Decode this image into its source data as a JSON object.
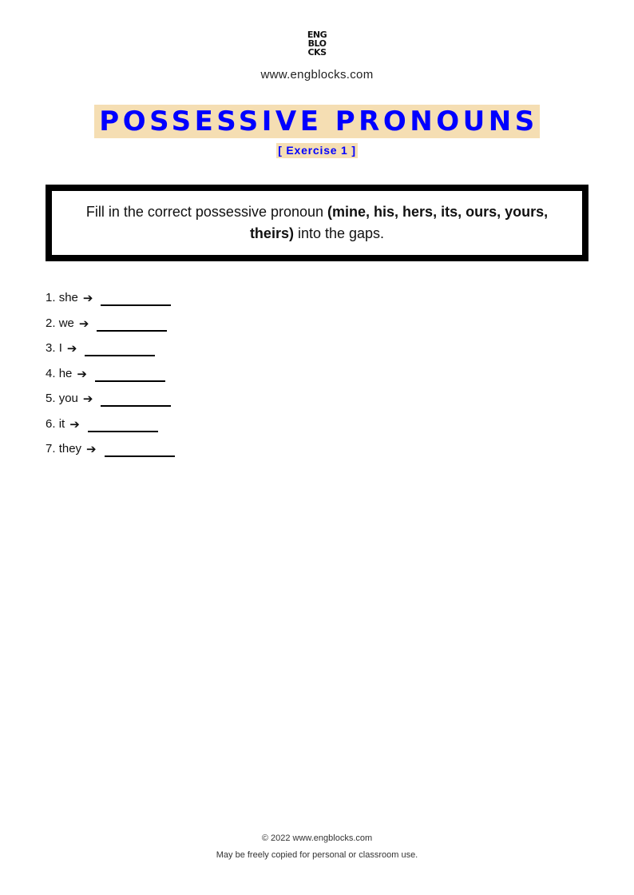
{
  "header": {
    "logo_lines": [
      "ENG",
      "BLO",
      "CKS"
    ],
    "site": "www.engblocks.com"
  },
  "title": "POSSESSIVE PRONOUNS",
  "subtitle": "[ Exercise 1 ]",
  "colors": {
    "accent": "#0000ff",
    "highlight": "#f5deb3"
  },
  "instructions": {
    "prefix": "Fill in the correct possessive pronoun ",
    "bold": "(mine, his, hers, its, ours, yours, theirs)",
    "suffix": " into the gaps."
  },
  "exercises": [
    {
      "number": "1.",
      "word": "she",
      "arrow": "➔",
      "answer": ""
    },
    {
      "number": "2.",
      "word": "we",
      "arrow": "➔",
      "answer": ""
    },
    {
      "number": "3.",
      "word": "I",
      "arrow": "➔",
      "answer": ""
    },
    {
      "number": "4.",
      "word": "he",
      "arrow": "➔",
      "answer": ""
    },
    {
      "number": "5.",
      "word": "you",
      "arrow": "➔",
      "answer": ""
    },
    {
      "number": "6.",
      "word": "it",
      "arrow": "➔",
      "answer": ""
    },
    {
      "number": "7.",
      "word": "they",
      "arrow": "➔",
      "answer": ""
    }
  ],
  "footer": {
    "copyright": "© 2022 www.engblocks.com",
    "license": "May be freely copied for personal or classroom use."
  }
}
